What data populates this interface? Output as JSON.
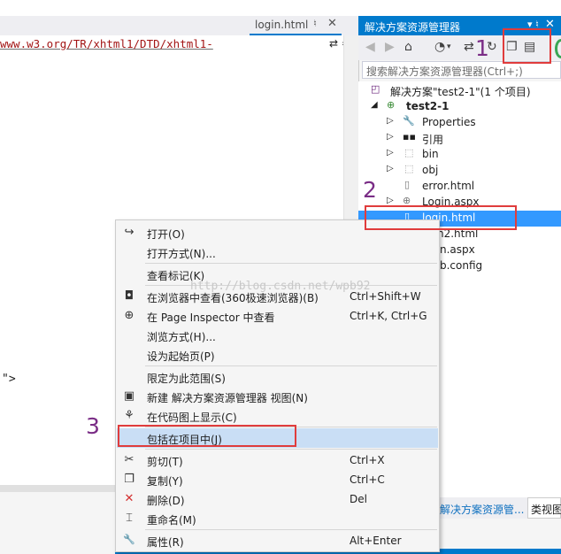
{
  "editor": {
    "tab_title": "login.html",
    "tab_pin": "♮",
    "tab_close": "✕",
    "code_line": "www.w3.org/TR/xhtml1/DTD/xhtml1-",
    "split_icon": "⇄ ≑",
    "code_snippet": "\">"
  },
  "solution_explorer": {
    "title": "解决方案资源管理器",
    "pin": "▾ ♮",
    "close": "✕",
    "search_placeholder": "搜索解决方案资源管理器(Ctrl+;)",
    "tree": [
      {
        "label": "解决方案\"test2-1\"(1 个项目)",
        "icon": "solution-icon",
        "level": 0,
        "expanded": null
      },
      {
        "label": "test2-1",
        "icon": "web-project-icon",
        "level": 1,
        "expanded": true,
        "bold": true
      },
      {
        "label": "Properties",
        "icon": "wrench-icon",
        "level": 2,
        "expanded": false
      },
      {
        "label": "引用",
        "icon": "references-icon",
        "level": 2,
        "expanded": false
      },
      {
        "label": "bin",
        "icon": "folder-icon",
        "level": 2,
        "expanded": false
      },
      {
        "label": "obj",
        "icon": "folder-icon",
        "level": 2,
        "expanded": false
      },
      {
        "label": "error.html",
        "icon": "html-file-icon",
        "level": 2,
        "expanded": null
      },
      {
        "label": "Login.aspx",
        "icon": "aspx-file-icon",
        "level": 2,
        "expanded": false
      },
      {
        "label": "login.html",
        "icon": "html-file-icon",
        "level": 2,
        "expanded": null,
        "selected": true
      },
      {
        "label": "n2.html",
        "level": 2
      },
      {
        "label": "n.aspx",
        "level": 2
      },
      {
        "label": "b.config",
        "level": 2
      }
    ],
    "bottom_tabs": [
      "解决方案资源管...",
      "类视图"
    ]
  },
  "context_menu": {
    "items": [
      {
        "icon": "open-arrow-icon",
        "glyph": "↪",
        "label": "打开(O)",
        "shortcut": ""
      },
      {
        "icon": "",
        "glyph": "",
        "label": "打开方式(N)...",
        "shortcut": ""
      },
      {
        "sep": true
      },
      {
        "icon": "",
        "glyph": "",
        "label": "查看标记(K)",
        "shortcut": ""
      },
      {
        "sep": true
      },
      {
        "icon": "browser-icon",
        "glyph": "◘",
        "label": "在浏览器中查看(360极速浏览器)(B)",
        "shortcut": "Ctrl+Shift+W"
      },
      {
        "icon": "page-inspector-icon",
        "glyph": "⊕",
        "label": "在 Page Inspector 中查看",
        "shortcut": "Ctrl+K, Ctrl+G"
      },
      {
        "icon": "",
        "glyph": "",
        "label": "浏览方式(H)...",
        "shortcut": ""
      },
      {
        "icon": "",
        "glyph": "",
        "label": "设为起始页(P)",
        "shortcut": ""
      },
      {
        "sep": true
      },
      {
        "icon": "",
        "glyph": "",
        "label": "限定为此范围(S)",
        "shortcut": ""
      },
      {
        "icon": "new-view-icon",
        "glyph": "▣",
        "label": "新建 解决方案资源管理器 视图(N)",
        "shortcut": ""
      },
      {
        "icon": "code-map-icon",
        "glyph": "⚘",
        "label": "在代码图上显示(C)",
        "shortcut": ""
      },
      {
        "sep": true
      },
      {
        "icon": "",
        "glyph": "",
        "label": "包括在项目中(J)",
        "shortcut": "",
        "highlight": true
      },
      {
        "sep": true
      },
      {
        "icon": "scissors-icon",
        "glyph": "✂",
        "label": "剪切(T)",
        "shortcut": "Ctrl+X"
      },
      {
        "icon": "copy-icon",
        "glyph": "❐",
        "label": "复制(Y)",
        "shortcut": "Ctrl+C"
      },
      {
        "icon": "delete-x-icon",
        "glyph": "✕",
        "label": "删除(D)",
        "shortcut": "Del"
      },
      {
        "icon": "rename-icon",
        "glyph": "⌶",
        "label": "重命名(M)",
        "shortcut": ""
      },
      {
        "sep": true
      },
      {
        "icon": "wrench-icon",
        "glyph": "🔧",
        "label": "属性(R)",
        "shortcut": "Alt+Enter"
      }
    ]
  },
  "annotations": {
    "one": "1",
    "two": "2",
    "three": "3",
    "watermark": "http://blog.csdn.net/wpb92"
  },
  "colors": {
    "accent": "#007acc",
    "selection": "#3399ff",
    "menu_highlight": "#c9def5",
    "annotation_box": "#e03c3c",
    "annotation_text": "#7a2d86"
  }
}
